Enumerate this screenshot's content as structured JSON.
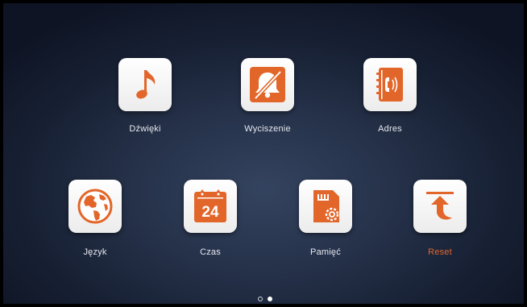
{
  "accent_color": "#e2662a",
  "label_color": "#e6e9ef",
  "page_indicator": {
    "total": 2,
    "current": 2
  },
  "menu": {
    "items": [
      {
        "id": "sounds",
        "label": "Dźwięki",
        "icon": "music-note-icon"
      },
      {
        "id": "mute",
        "label": "Wyciszenie",
        "icon": "muted-bell-icon"
      },
      {
        "id": "address",
        "label": "Adres",
        "icon": "address-book-icon"
      },
      {
        "id": "language",
        "label": "Język",
        "icon": "globe-icon"
      },
      {
        "id": "time",
        "label": "Czas",
        "icon": "calendar-icon"
      },
      {
        "id": "memory",
        "label": "Pamięć",
        "icon": "sd-card-settings-icon"
      },
      {
        "id": "reset",
        "label": "Reset",
        "icon": "reset-arrow-icon",
        "highlighted": true
      }
    ],
    "calendar_day": "24"
  }
}
